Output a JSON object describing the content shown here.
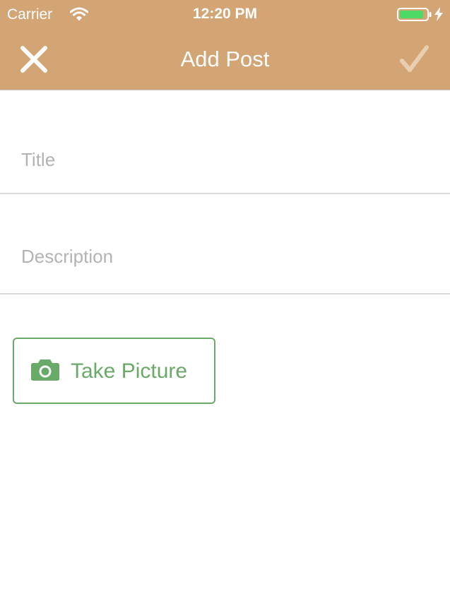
{
  "status_bar": {
    "carrier": "Carrier",
    "time": "12:20 PM",
    "battery_icon": "battery-charging-icon",
    "wifi_icon": "wifi-icon",
    "charging_icon": "bolt-icon"
  },
  "nav": {
    "title": "Add Post",
    "close_icon": "close-icon",
    "done_icon": "checkmark-icon"
  },
  "form": {
    "title_field": {
      "value": "",
      "placeholder": "Title"
    },
    "description_field": {
      "value": "",
      "placeholder": "Description"
    },
    "take_picture": {
      "label": "Take Picture",
      "icon": "camera-icon"
    }
  },
  "colors": {
    "nav_background": "#d4a574",
    "accent_green": "#6aaa68",
    "placeholder_gray": "#b3b3b3",
    "battery_fill": "#4cd964"
  }
}
